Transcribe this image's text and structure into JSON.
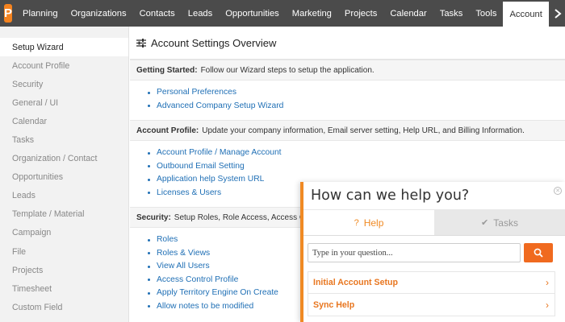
{
  "nav": {
    "logo_letter": "P",
    "items": [
      {
        "label": "Planning"
      },
      {
        "label": "Organizations"
      },
      {
        "label": "Contacts"
      },
      {
        "label": "Leads"
      },
      {
        "label": "Opportunities"
      },
      {
        "label": "Marketing"
      },
      {
        "label": "Projects"
      },
      {
        "label": "Calendar"
      },
      {
        "label": "Tasks"
      },
      {
        "label": "Tools"
      },
      {
        "label": "Account",
        "active": true
      }
    ],
    "more_icon": "chevron-right-icon"
  },
  "sidebar": {
    "items": [
      {
        "label": "Setup Wizard",
        "active": true
      },
      {
        "label": "Account Profile"
      },
      {
        "label": "Security"
      },
      {
        "label": "General / UI"
      },
      {
        "label": "Calendar"
      },
      {
        "label": "Tasks"
      },
      {
        "label": "Organization / Contact"
      },
      {
        "label": "Opportunities"
      },
      {
        "label": "Leads"
      },
      {
        "label": "Template / Material"
      },
      {
        "label": "Campaign"
      },
      {
        "label": "File"
      },
      {
        "label": "Projects"
      },
      {
        "label": "Timesheet"
      },
      {
        "label": "Custom Field"
      }
    ]
  },
  "main": {
    "title": "Account Settings Overview",
    "title_icon": "sliders-icon",
    "sections": [
      {
        "heading": "Getting Started:",
        "description": "Follow our Wizard steps to setup the application.",
        "links": [
          "Personal Preferences",
          "Advanced Company Setup Wizard"
        ]
      },
      {
        "heading": "Account Profile:",
        "description": "Update your company information, Email server setting, Help URL, and Billing Information.",
        "links": [
          "Account Profile / Manage Account",
          "Outbound Email Setting",
          "Application help System URL",
          "Licenses & Users"
        ]
      },
      {
        "heading": "Security:",
        "description": "Setup Roles, Role Access, Access C",
        "links": [
          "Roles",
          "Roles & Views",
          "View All Users",
          "Access Control Profile",
          "Apply Territory Engine On Create",
          "Allow notes to be modified"
        ]
      }
    ]
  },
  "help_widget": {
    "title": "How can we help you?",
    "close_icon": "close-icon",
    "tabs": [
      {
        "label": "Help",
        "icon": "question-icon",
        "active": true
      },
      {
        "label": "Tasks",
        "icon": "check-icon",
        "active": false
      }
    ],
    "search_placeholder": "Type in your question...",
    "search_icon": "search-icon",
    "articles": [
      "Initial Account Setup",
      "Sync Help"
    ]
  },
  "colors": {
    "nav_bg": "#4b4b4b",
    "brand_orange": "#f5831f",
    "link_blue": "#1f6fb5",
    "help_accent": "#f08a24"
  }
}
